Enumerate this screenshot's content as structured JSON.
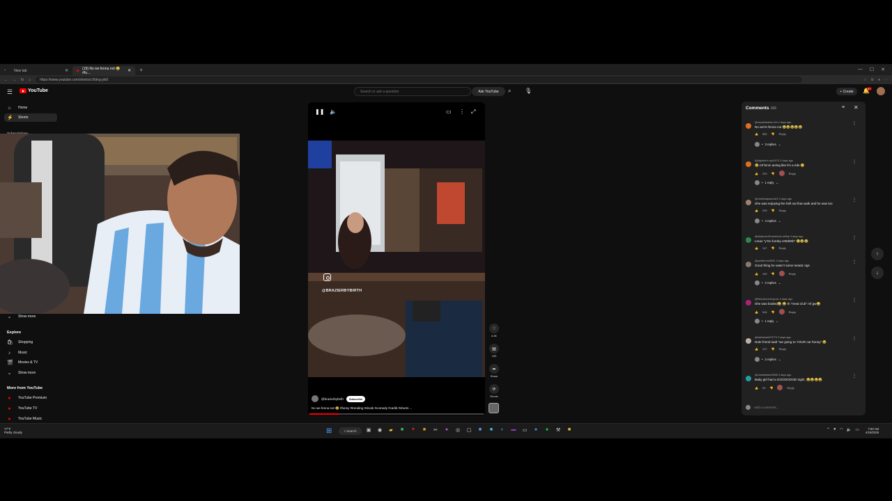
{
  "browser": {
    "tabs": [
      {
        "title": "New tab",
        "active": false
      },
      {
        "title": "(19) No we fenna not 😂 #fu…",
        "active": true
      }
    ],
    "url": "https://www.youtube.com/shorts/cXbtng-jxk0"
  },
  "masthead": {
    "search_placeholder": "Search or ask a question",
    "ask_label": "Ask YouTube",
    "create_label": "Create",
    "notif_count": "9+"
  },
  "sidebar": {
    "items": [
      {
        "label": "Home",
        "icon": "home-icon"
      },
      {
        "label": "Shorts",
        "icon": "shorts-icon"
      }
    ],
    "subs_head": "Subscriptions",
    "show_more_1": "Show more",
    "explore_head": "Explore",
    "explore": [
      {
        "label": "Shopping",
        "icon": "shopping-icon"
      },
      {
        "label": "Music",
        "icon": "music-icon"
      },
      {
        "label": "Movies & TV",
        "icon": "movies-icon"
      }
    ],
    "show_more_2": "Show more",
    "more_head": "More from YouTube",
    "more": [
      {
        "label": "YouTube Premium"
      },
      {
        "label": "YouTube TV"
      },
      {
        "label": "YouTube Music"
      }
    ]
  },
  "player": {
    "watermark": "@BRAZIERBYBIRTH",
    "channel": "@brazierbybirth",
    "subscribe_label": "Subscribe",
    "caption": "No we fenna not 😂 #funny #trending #drunk #comedy #carlib #shorts ...",
    "progress": 0.17
  },
  "actions": {
    "like_count": "4.3K",
    "comment_count": "169",
    "share_label": "Share",
    "remix_label": "Remix"
  },
  "comments": {
    "title": "Comments",
    "count": "169",
    "list": [
      {
        "user": "@oscyblckstds-x2h",
        "time": "4 days ago",
        "text": "No we're fenna not 😂😂😂😂😂",
        "likes": "650",
        "replies": "3 replies",
        "avatar": "#e07020",
        "hearted": false
      },
      {
        "user": "@jrigoberto ayo2474",
        "time": "3 days ago",
        "text": "😂 mf fenni acting like it's a ride 😢",
        "likes": "220",
        "replies": "1 reply",
        "avatar": "#e07020",
        "hearted": true
      },
      {
        "user": "@christinapaioc4d3",
        "time": "3 days ago",
        "text": "She was enjoying the hell out that walk and he was too",
        "likes": "299",
        "replies": "4 replies",
        "avatar": "#a08070",
        "hearted": false
      },
      {
        "user": "@AlejandroRostokovic-vk9bp",
        "time": "3 days ago",
        "text": "Lmao \"y'Oo furnby c00d00b\" 😂😂😂",
        "likes": "147",
        "replies": "",
        "avatar": "#2a8a4a",
        "hearted": false
      },
      {
        "user": "@pantferros5394",
        "time": "3 days ago",
        "text": "Good thing he wasn't some lunatic ngs",
        "likes": "192",
        "replies": "2 replies",
        "avatar": "#8a7a6a",
        "hearted": true
      },
      {
        "user": "@friendzoneIvoyurix",
        "time": "4 days ago",
        "text": "She was bodied😂 😂 th \"meat club\" mf gw😂",
        "likes": "516",
        "replies": "1 reply",
        "avatar": "#b0207a",
        "hearted": true
      },
      {
        "user": "@ballmeart873773",
        "time": "3 days ago",
        "text": "Note friend said \"we going to YOUR car honey\" 😂",
        "likes": "127",
        "replies": "2 replies",
        "avatar": "#c0b0a0",
        "hearted": false
      },
      {
        "user": "@zombaskarz5068",
        "time": "3 days ago",
        "text": "Baby girl had a GOOOOOOD night. 😂😂😂😂",
        "likes": "93",
        "replies": "",
        "avatar": "#20a0a0",
        "hearted": true
      }
    ],
    "reply_label": "Reply",
    "add_placeholder": "Add a comment..."
  },
  "taskbar": {
    "weather_temp": "77°F",
    "weather_desc": "Partly cloudy",
    "search_label": "Search",
    "time": "7:50 AM",
    "date": "4/19/2026"
  }
}
